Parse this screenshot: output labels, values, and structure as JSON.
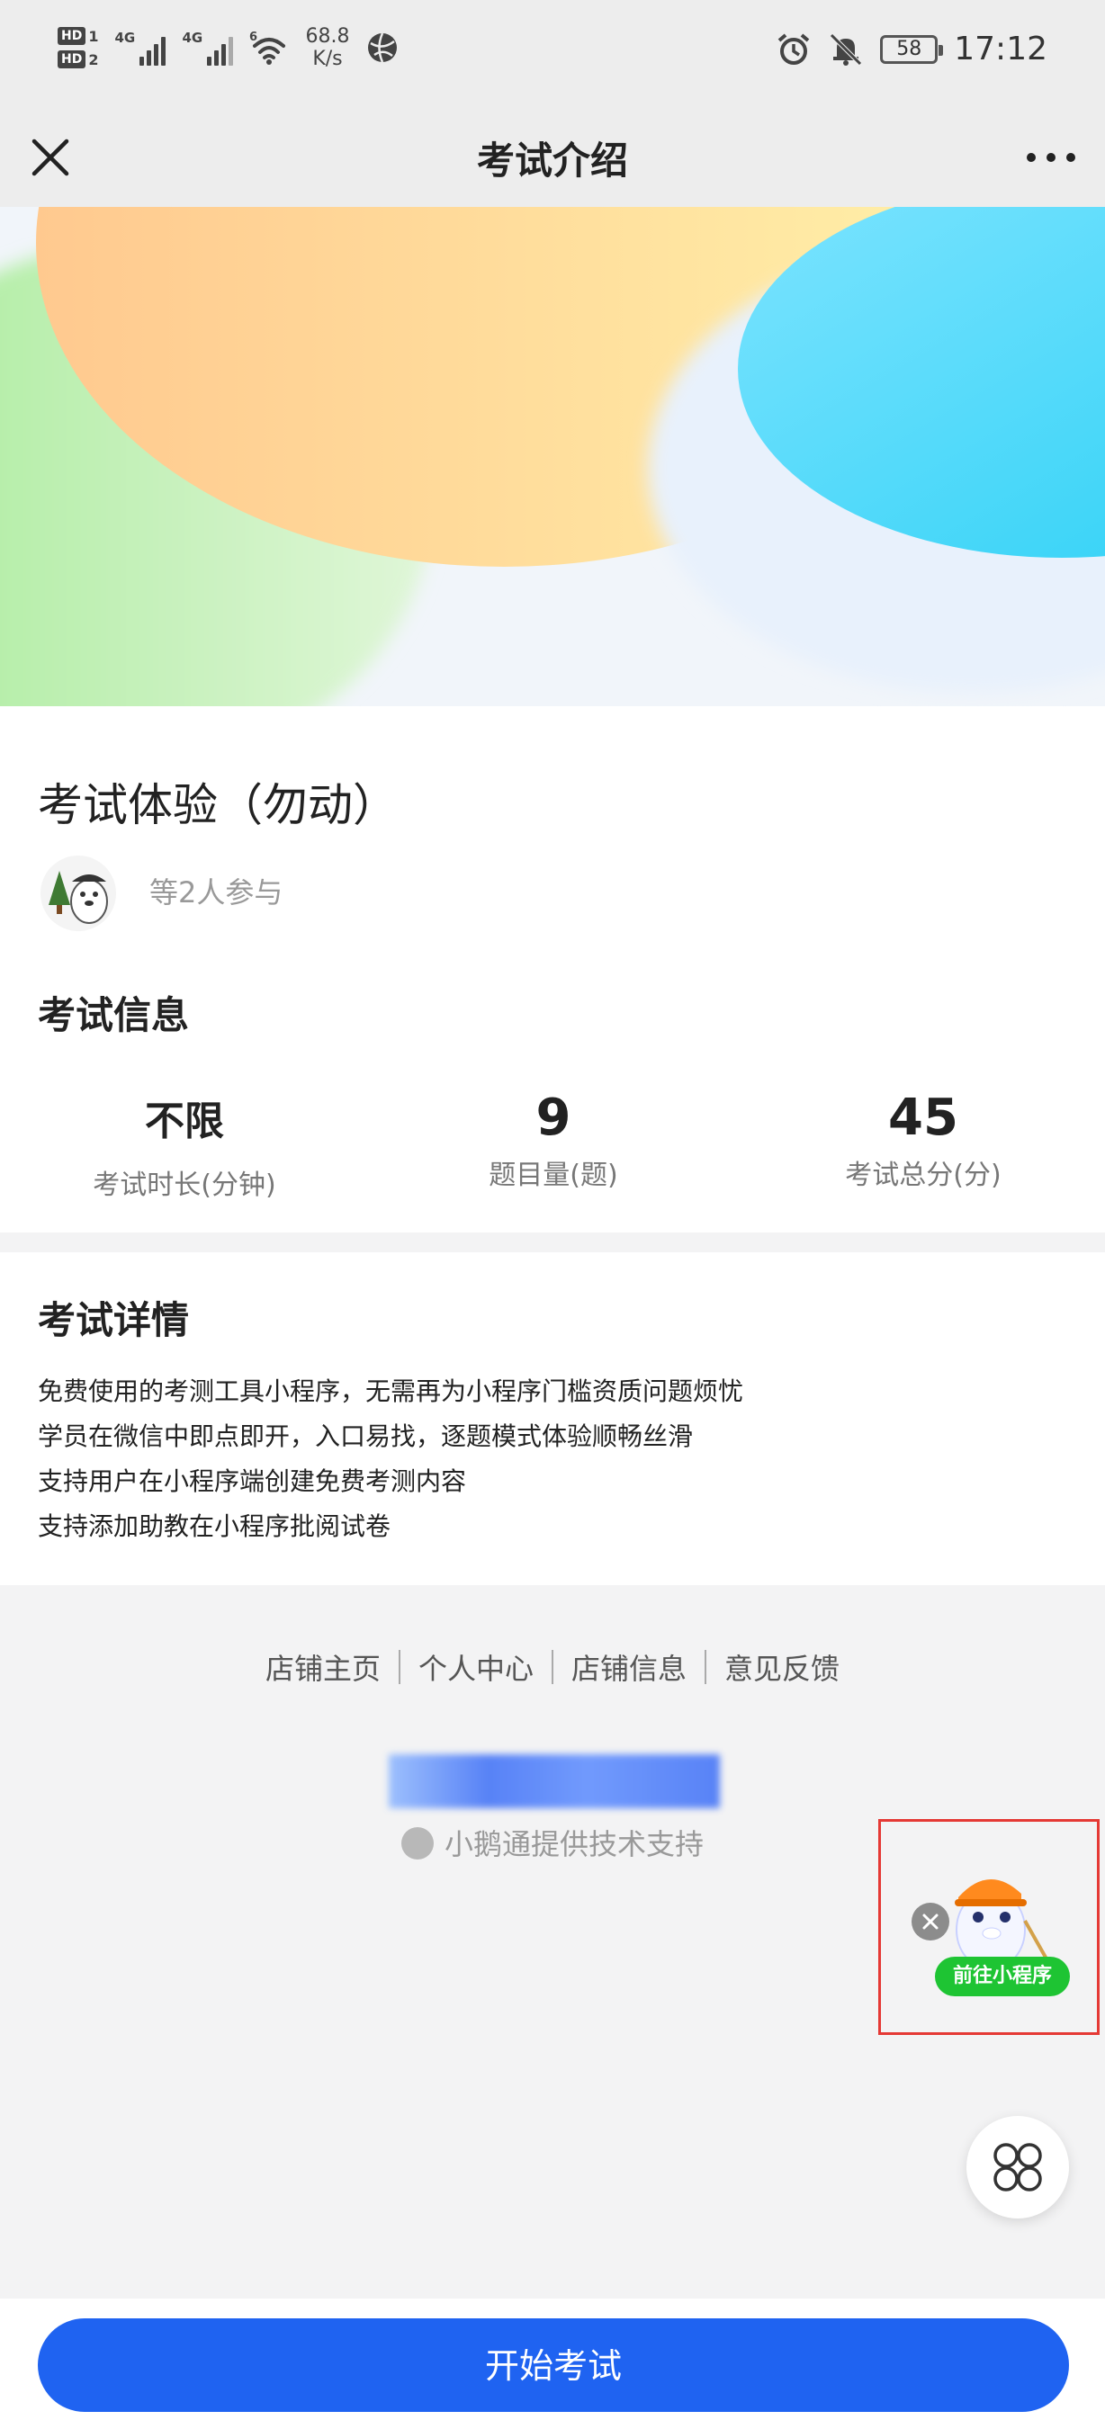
{
  "status_bar": {
    "sim1_label": "HD",
    "sim1_index": "1",
    "sim2_label": "HD",
    "sim2_index": "2",
    "net1": "4G",
    "net2": "4G",
    "wifi_label": "6",
    "speed_value": "68.8",
    "speed_unit": "K/s",
    "battery": "58",
    "time": "17:12",
    "icons": [
      "signal-icon",
      "wifi-icon",
      "globe-icon",
      "alarm-icon",
      "mute-icon",
      "battery-icon"
    ]
  },
  "nav": {
    "title": "考试介绍",
    "close_icon": "close-icon",
    "more_icon": "more-icon"
  },
  "exam": {
    "title": "考试体验（勿动）",
    "participants": "等2人参与"
  },
  "info": {
    "section_title": "考试信息",
    "stats": [
      {
        "value": "不限",
        "label": "考试时长(分钟)"
      },
      {
        "value": "9",
        "label": "题目量(题)"
      },
      {
        "value": "45",
        "label": "考试总分(分)"
      }
    ]
  },
  "detail": {
    "section_title": "考试详情",
    "lines": [
      "免费使用的考测工具小程序，无需再为小程序门槛资质问题烦忧",
      "学员在微信中即点即开，入口易找，逐题模式体验顺畅丝滑",
      "支持用户在小程序端创建免费考测内容",
      "支持添加助教在小程序批阅试卷"
    ]
  },
  "footer": {
    "links": [
      "店铺主页",
      "个人中心",
      "店铺信息",
      "意见反馈"
    ],
    "powered_by": "小鹅通提供技术支持"
  },
  "mini_program": {
    "button_label": "前往小程序"
  },
  "actions": {
    "start_label": "开始考试"
  },
  "colors": {
    "primary": "#1f63f1",
    "mini_program_green": "#1ec433",
    "highlight_border": "#e53935"
  }
}
